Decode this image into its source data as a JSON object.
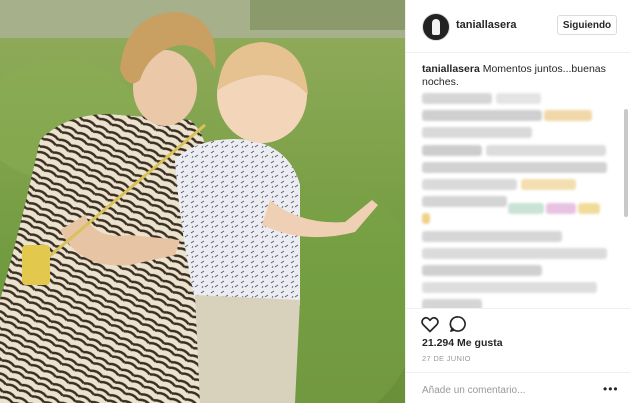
{
  "post": {
    "username": "taniallasera",
    "follow_label": "Siguiendo",
    "caption_user": "taniallasera",
    "caption_text": "Momentos juntos...buenas noches.",
    "likes": "21.294 Me gusta",
    "date": "27 DE JUNIO",
    "comment_placeholder": "Añade un comentario...",
    "more_label": "•••"
  },
  "icons": {
    "like": "heart-icon",
    "comment": "comment-icon",
    "options": "ellipsis-icon"
  },
  "colors": {
    "text": "#262626",
    "muted": "#999999",
    "border": "#efefef"
  }
}
